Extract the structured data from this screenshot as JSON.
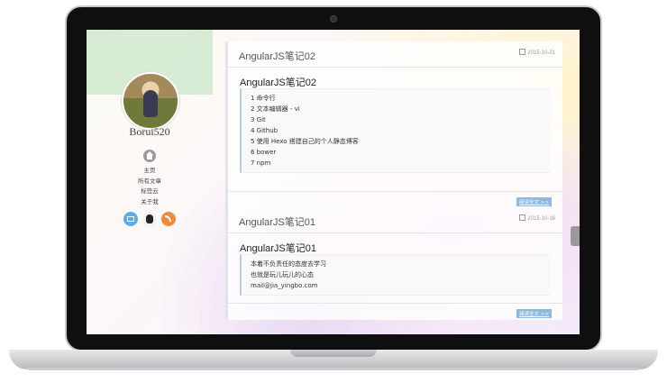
{
  "site": {
    "name": "Borui520"
  },
  "nav": {
    "items": [
      "主页",
      "所有文章",
      "标签云",
      "关于我"
    ]
  },
  "social": [
    "mail-icon",
    "github-icon",
    "rss-icon"
  ],
  "posts": [
    {
      "header": "AngularJS笔记02",
      "date": "2015-10-21",
      "title": "AngularJS笔记02",
      "lines": [
        "1 命令行",
        "2 文本编辑器 - vi",
        "3 Git",
        "4 Github",
        "5 使用 Hexo 搭建自己的个人静态博客",
        "6 bower",
        "7 npm"
      ],
      "readmore": "阅读全文 >>"
    },
    {
      "header": "AngularJS笔记01",
      "date": "2015-10-16",
      "title": "AngularJS笔记01",
      "lines": [
        "本着不负责任的态度去学习",
        "也就是玩儿玩儿的心态",
        "mail@jia_yingbo.com"
      ],
      "readmore": "阅读全文 >>"
    }
  ]
}
